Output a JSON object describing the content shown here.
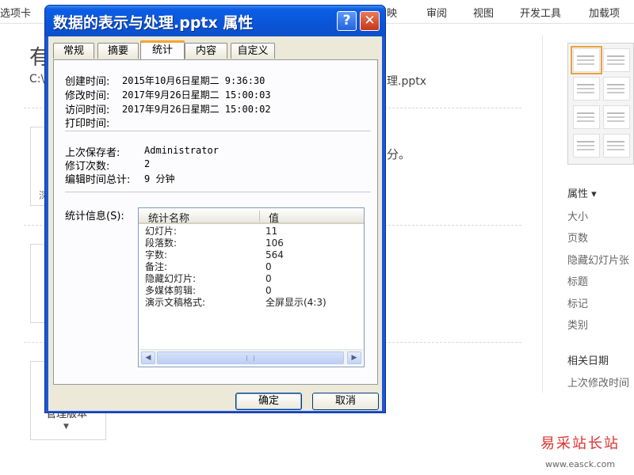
{
  "ribbon": {
    "tabs": [
      "选项卡",
      "映",
      "审阅",
      "视图",
      "开发工具",
      "加载项"
    ]
  },
  "background": {
    "title_fragment": "有",
    "path_start": "C:\\",
    "path_end": "理.pptx",
    "partial_text": "分。",
    "edge_char": "深",
    "card_label": "管理版本",
    "card_arrow": "▼"
  },
  "info_panel": {
    "properties_header": "属性 ▾",
    "properties": [
      "大小",
      "页数",
      "隐藏幻灯片张",
      "标题",
      "标记",
      "类别"
    ],
    "related_dates_header": "相关日期",
    "last_modified_label": "上次修改时间"
  },
  "dialog": {
    "title": "数据的表示与处理.pptx 属性",
    "help_label": "?",
    "close_label": "✕",
    "tabs": [
      "常规",
      "摘要",
      "统计",
      "内容",
      "自定义"
    ],
    "active_tab": "统计",
    "dates": [
      {
        "label": "创建时间:",
        "value": "2015年10月6日星期二 9:36:30"
      },
      {
        "label": "修改时间:",
        "value": "2017年9月26日星期二 15:00:03"
      },
      {
        "label": "访问时间:",
        "value": "2017年9月26日星期二 15:00:02"
      },
      {
        "label": "打印时间:",
        "value": ""
      }
    ],
    "saved": [
      {
        "label": "上次保存者:",
        "value": "Administrator"
      },
      {
        "label": "修订次数:",
        "value": "2"
      },
      {
        "label": "编辑时间总计:",
        "value": "9 分钟"
      }
    ],
    "stats_label": "统计信息(S):",
    "stats_columns": [
      "统计名称",
      "值"
    ],
    "stats_rows": [
      {
        "name": "幻灯片:",
        "value": "11"
      },
      {
        "name": "段落数:",
        "value": "106"
      },
      {
        "name": "字数:",
        "value": "564"
      },
      {
        "name": "备注:",
        "value": "0"
      },
      {
        "name": "隐藏幻灯片:",
        "value": "0"
      },
      {
        "name": "多媒体剪辑:",
        "value": "0"
      },
      {
        "name": "演示文稿格式:",
        "value": "全屏显示(4:3)"
      }
    ],
    "scroll_left": "◀",
    "scroll_right": "▶",
    "ok_label": "确定",
    "cancel_label": "取消"
  },
  "watermark": {
    "text": "易采站长站",
    "url": "www.easck.com"
  }
}
